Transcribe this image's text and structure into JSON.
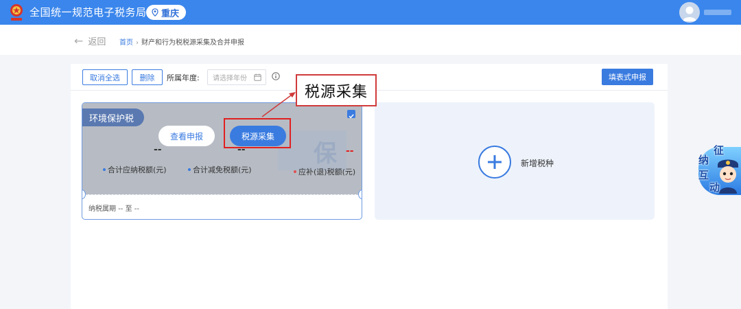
{
  "header": {
    "site_title": "全国统一规范电子税务局",
    "city": "重庆"
  },
  "breadcrumb": {
    "back_label": "返回",
    "home": "首页",
    "current": "财产和行为税税源采集及合并申报"
  },
  "toolbar": {
    "deselect_all": "取消全选",
    "delete": "删除",
    "year_label": "所属年度:",
    "year_placeholder": "请选择年份",
    "form_declare": "填表式申报"
  },
  "tax_card": {
    "name": "环境保护税",
    "watermark": "保",
    "view_declare": "查看申报",
    "source_collect": "税源采集",
    "values": {
      "payable": "--",
      "exempt": "--",
      "refund": "--"
    },
    "metrics": {
      "payable_label": "合计应纳税额(元)",
      "exempt_label": "合计减免税额(元)",
      "refund_label": "应补(退)税额(元)"
    },
    "period_label": "纳税属期",
    "period_value": "-- 至 --"
  },
  "add_card": {
    "label": "新增税种"
  },
  "annotation": {
    "callout_text": "税源采集"
  },
  "assistant": {
    "chars": [
      "征",
      "纳",
      "互",
      "动"
    ]
  },
  "colors": {
    "primary": "#3a7be0",
    "header": "#3a86ec",
    "highlight": "#e02020"
  }
}
